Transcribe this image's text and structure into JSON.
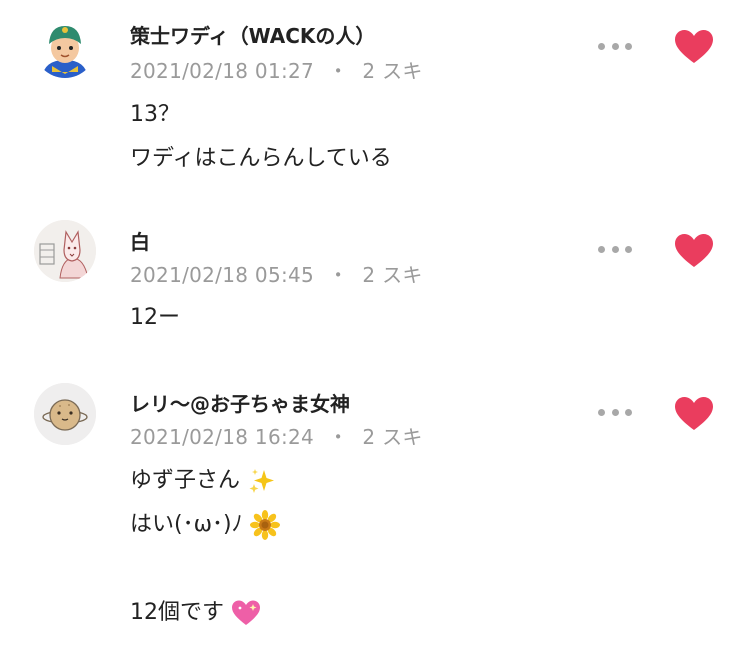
{
  "comments": [
    {
      "author": "策士ワディ（WACKの人）",
      "date": "2021/02/18 01:27",
      "separator": "・",
      "likes": "2 スキ",
      "lines": [
        "13？",
        "ワディはこんらんしている"
      ],
      "avatar_icon": "cartoon-person-avatar",
      "heart_color": "#ea3d5e"
    },
    {
      "author": "白",
      "date": "2021/02/18 05:45",
      "separator": "・",
      "likes": "2 スキ",
      "lines": [
        "12ー"
      ],
      "avatar_icon": "sketch-fox-avatar",
      "heart_color": "#ea3d5e"
    },
    {
      "author": "レリ〜@お子ちゃま女神",
      "date": "2021/02/18 16:24",
      "separator": "・",
      "likes": "2 スキ",
      "lines": [
        "ゆず子さん",
        "はい(･ω･)ﾉ",
        "",
        "12個です"
      ],
      "avatar_icon": "round-bun-avatar",
      "heart_color": "#ea3d5e"
    }
  ]
}
